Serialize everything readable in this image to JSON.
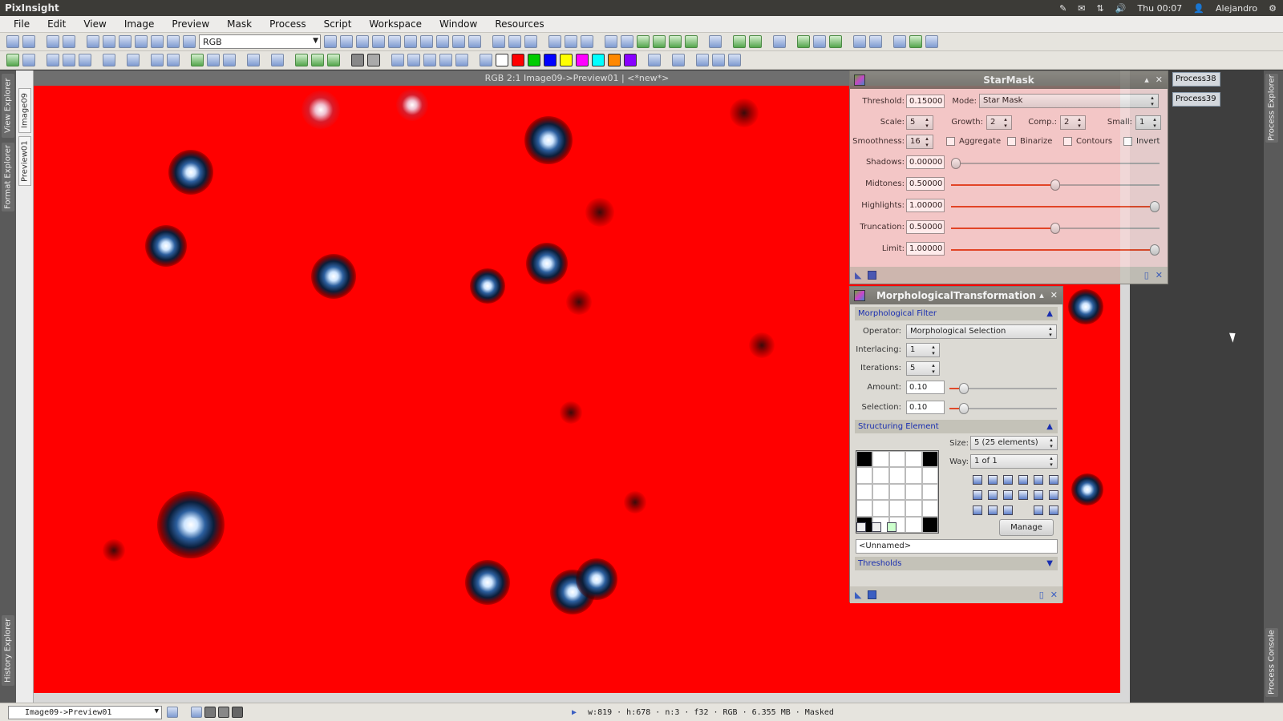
{
  "topbar": {
    "app_name": "PixInsight",
    "clock": "Thu 00:07",
    "user": "Alejandro"
  },
  "menu": [
    "File",
    "Edit",
    "View",
    "Image",
    "Preview",
    "Mask",
    "Process",
    "Script",
    "Workspace",
    "Window",
    "Resources"
  ],
  "toolbar": {
    "channel_select": "RGB"
  },
  "left_dock": {
    "tabs": [
      "View Explorer",
      "Format Explorer"
    ],
    "bottom_tab": "History Explorer"
  },
  "image_window": {
    "title": "RGB 2:1 Image09->Preview01 | <*new*>",
    "side_tabs": [
      "Image09",
      "Preview01"
    ]
  },
  "right_panel": {
    "process_tabs": [
      "Process38",
      "Process39"
    ],
    "dock_tabs": [
      "Process Explorer",
      "Process Console"
    ]
  },
  "starmask": {
    "title": "StarMask",
    "threshold_label": "Threshold:",
    "threshold": "0.15000",
    "mode_label": "Mode:",
    "mode": "Star Mask",
    "scale_label": "Scale:",
    "scale": "5",
    "growth_label": "Growth:",
    "growth": "2",
    "comp_label": "Comp.:",
    "comp": "2",
    "small_label": "Small:",
    "small": "1",
    "smoothness_label": "Smoothness:",
    "smoothness": "16",
    "aggregate_label": "Aggregate",
    "binarize_label": "Binarize",
    "contours_label": "Contours",
    "invert_label": "Invert",
    "shadows_label": "Shadows:",
    "shadows": "0.00000",
    "shadows_pos": 0.0,
    "midtones_label": "Midtones:",
    "midtones": "0.50000",
    "midtones_pos": 0.5,
    "highlights_label": "Highlights:",
    "highlights": "1.00000",
    "highlights_pos": 1.0,
    "truncation_label": "Truncation:",
    "truncation": "0.50000",
    "truncation_pos": 0.5,
    "limit_label": "Limit:",
    "limit": "1.00000",
    "limit_pos": 1.0
  },
  "morph": {
    "title": "MorphologicalTransformation",
    "section_filter": "Morphological Filter",
    "operator_label": "Operator:",
    "operator": "Morphological Selection",
    "interlacing_label": "Interlacing:",
    "interlacing": "1",
    "iterations_label": "Iterations:",
    "iterations": "5",
    "amount_label": "Amount:",
    "amount": "0.10",
    "amount_pos": 0.1,
    "selection_label": "Selection:",
    "selection": "0.10",
    "selection_pos": 0.1,
    "section_structuring": "Structuring Element",
    "size_label": "Size:",
    "size": "5  (25 elements)",
    "way_label": "Way:",
    "way": "1 of 1",
    "grid_on": [
      0,
      4,
      20,
      24
    ],
    "manage_label": "Manage",
    "name_field": "<Unnamed>",
    "section_thresholds": "Thresholds"
  },
  "statusbar": {
    "view": "Image09->Preview01",
    "info": [
      "w:819",
      "h:678",
      "n:3",
      "f32",
      "RGB",
      "6.355 MB",
      "Masked"
    ]
  },
  "colors": {
    "canvas": "#ff0000",
    "accent": "#e04a2a",
    "section_text": "#1a2fb0"
  }
}
